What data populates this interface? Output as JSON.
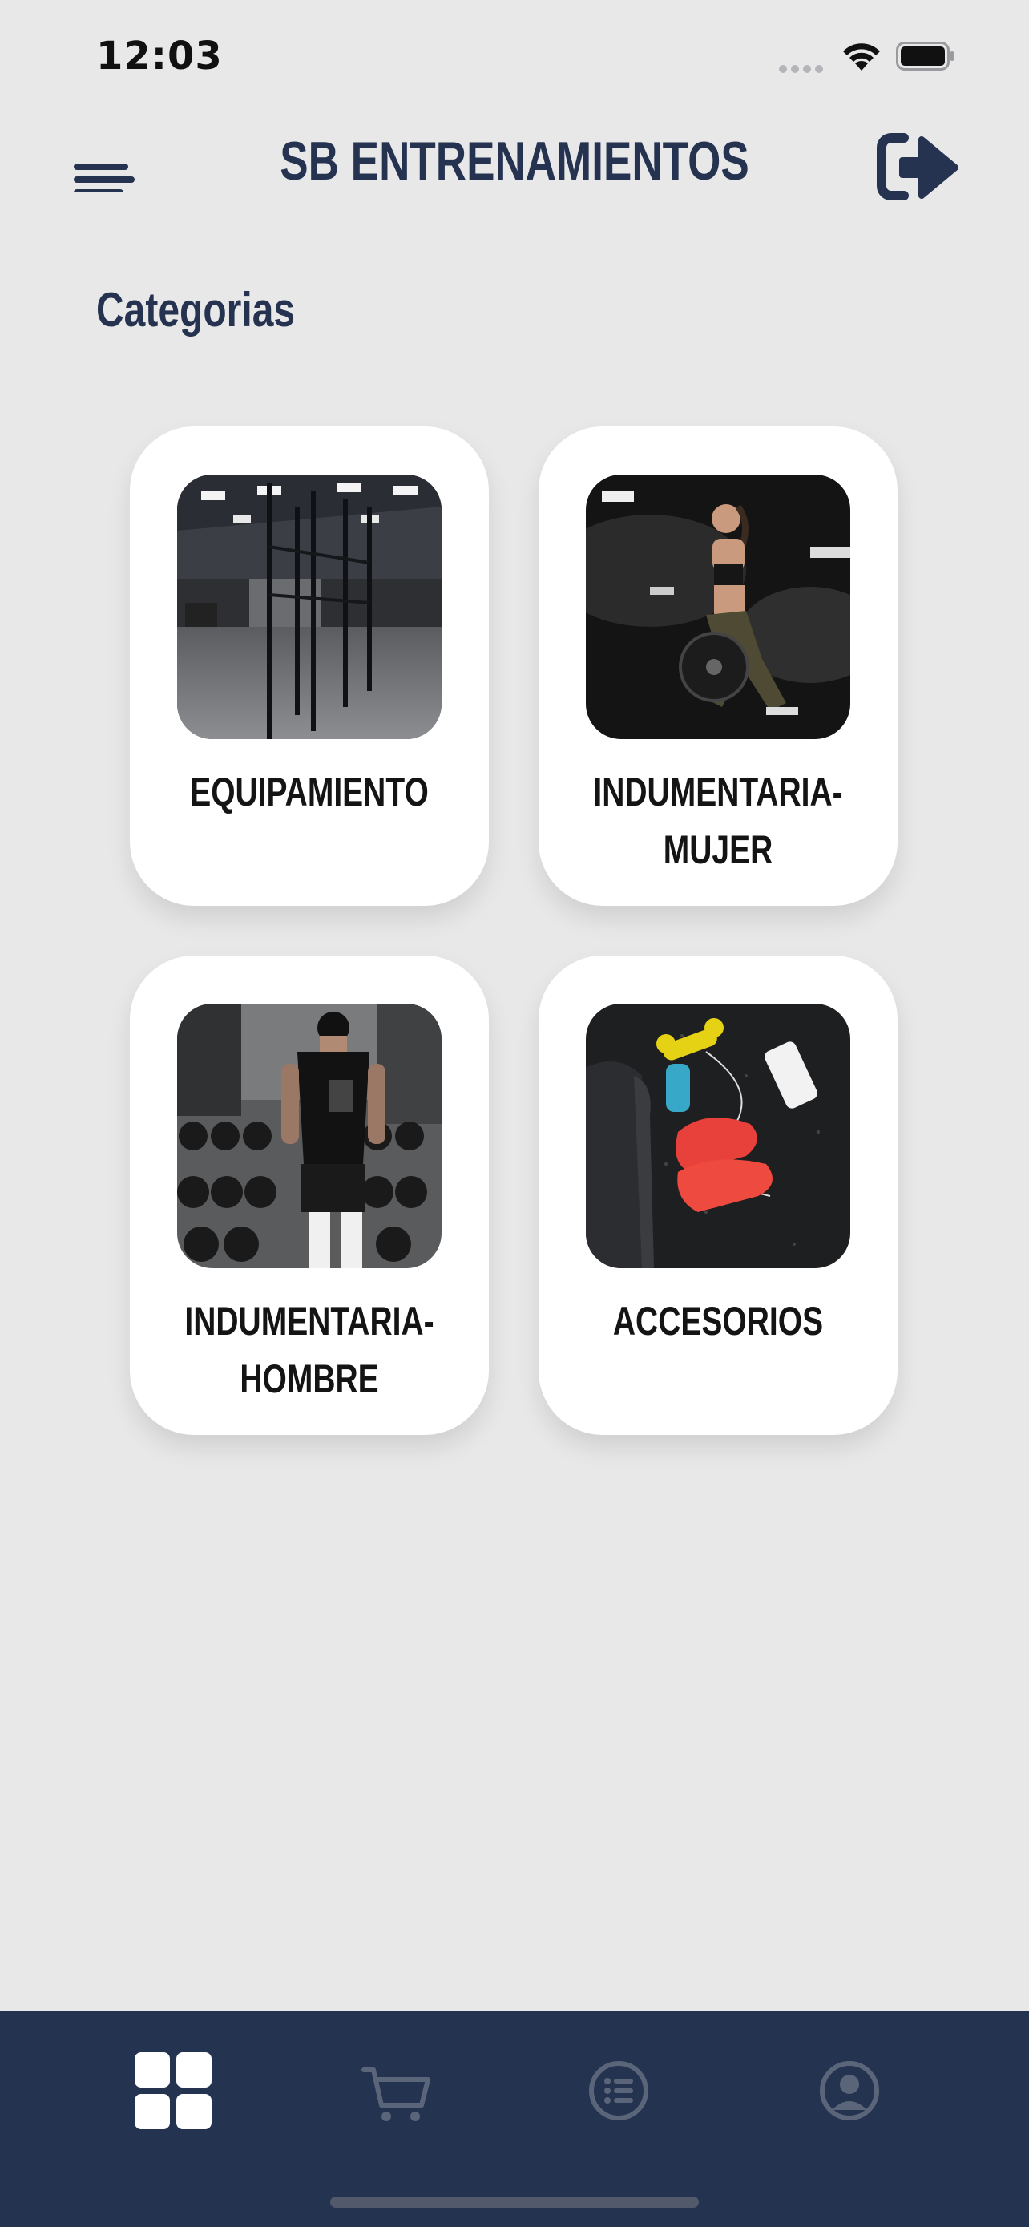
{
  "status_bar": {
    "time": "12:03"
  },
  "header": {
    "title": "SB ENTRENAMIENTOS",
    "menu_icon": "hamburger-menu-icon",
    "logout_icon": "logout-icon"
  },
  "section": {
    "title": "Categorias"
  },
  "categories": [
    {
      "label_line1": "EQUIPAMIENTO",
      "label_line2": "",
      "image": "gym-rigs-photo"
    },
    {
      "label_line1": "INDUMENTARIA-",
      "label_line2": "MUJER",
      "image": "woman-training-photo"
    },
    {
      "label_line1": "INDUMENTARIA-",
      "label_line2": "HOMBRE",
      "image": "man-dumbbells-photo"
    },
    {
      "label_line1": "ACCESORIOS",
      "label_line2": "",
      "image": "sneakers-accessories-photo"
    }
  ],
  "bottom_nav": {
    "items": [
      {
        "icon": "grid-icon",
        "active": true
      },
      {
        "icon": "cart-icon",
        "active": false
      },
      {
        "icon": "list-icon",
        "active": false
      },
      {
        "icon": "profile-icon",
        "active": false
      }
    ]
  },
  "colors": {
    "primary": "#253350",
    "background": "#e8e8e9",
    "card": "#ffffff",
    "nav_inactive": "#5b6579"
  }
}
